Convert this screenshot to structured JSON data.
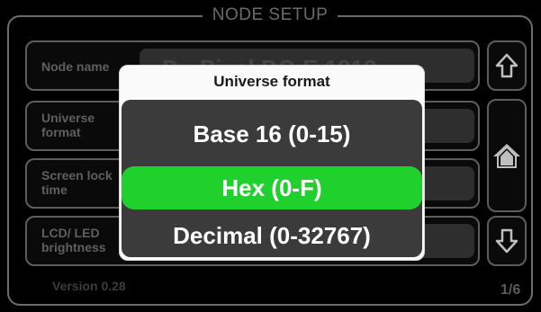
{
  "header": {
    "title": "NODE SETUP"
  },
  "rows": [
    {
      "label": "Node name",
      "value": "Dr. Pixel DC-E 1212"
    },
    {
      "label": "Universe format",
      "value": ""
    },
    {
      "label": "Screen lock time",
      "value": ""
    },
    {
      "label": "LCD/ LED brightness",
      "value": ""
    }
  ],
  "row_labels_lines": [
    [
      "Node name"
    ],
    [
      "Universe",
      "format"
    ],
    [
      "Screen lock",
      "time"
    ],
    [
      "LCD/ LED",
      "brightness"
    ]
  ],
  "side_buttons": {
    "up_icon": "arrow-up-icon",
    "home_icon": "home-icon",
    "down_icon": "arrow-down-icon"
  },
  "footer": {
    "version": "Version 0.28",
    "page": "1/6"
  },
  "popup": {
    "title": "Universe format",
    "options": [
      {
        "label": "Base 16 (0-15)",
        "selected": false
      },
      {
        "label": "Hex (0-F)",
        "selected": true
      },
      {
        "label": "Decimal (0-32767)",
        "selected": false
      }
    ]
  },
  "colors": {
    "selected": "#20d12e",
    "list_bg": "#3b3b3b",
    "popup_bg": "#fafafa",
    "frame": "#6c6c6c"
  }
}
